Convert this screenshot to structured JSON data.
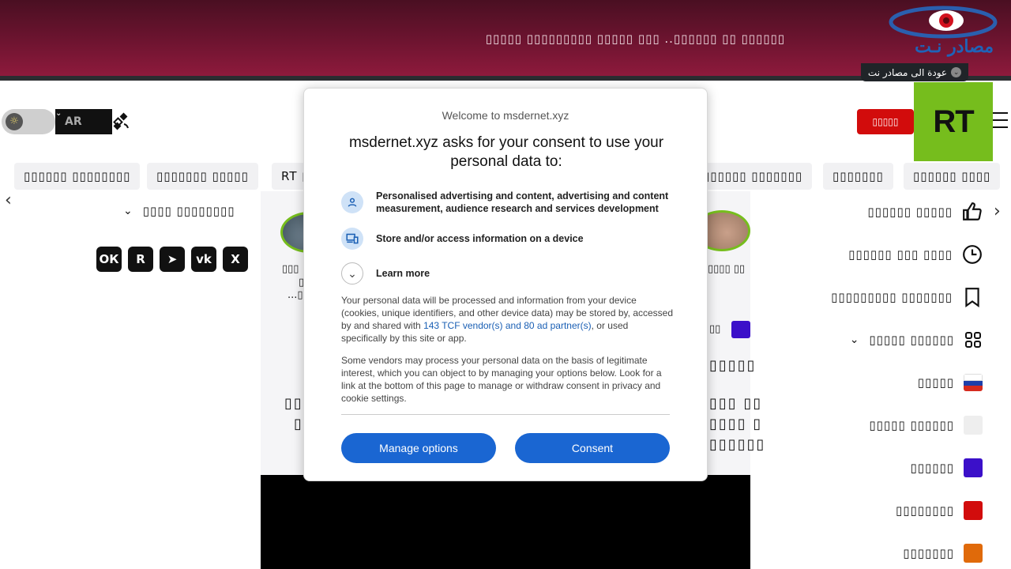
{
  "banner": {
    "headline": "▯▯▯▯▯ ▯▯▯▯▯▯▯▯▯ ▯▯▯▯▯ ▯▯▯ ..▯▯▯▯▯▯ ▯▯ ▯▯▯▯▯▯",
    "logo_word": "مصادر نـت",
    "back_link": "عودة الى مصادر نت"
  },
  "header": {
    "logo": "RT",
    "live_label": "▯▯▯▯▯",
    "language": "AR"
  },
  "nav": {
    "items": [
      "▯▯▯▯▯▯ ▯▯▯▯▯▯▯▯",
      "▯▯▯▯▯▯▯ ▯▯▯▯▯",
      "RT ▯",
      "▯▯▯▯▯▯ ▯▯▯▯▯▯▯",
      "▯▯▯▯▯▯▯",
      "▯▯▯▯▯▯ ▯▯▯▯"
    ]
  },
  "sidebar": {
    "items": [
      {
        "label": "▯▯▯▯▯▯ ▯▯▯▯▯",
        "icon": "thumbs-up-icon"
      },
      {
        "label": "▯▯▯▯▯▯ ▯▯▯ ▯▯▯▯",
        "icon": "clock-icon"
      },
      {
        "label": "▯▯▯▯▯▯▯▯▯ ▯▯▯▯▯▯▯",
        "icon": "bookmark-icon"
      },
      {
        "label": "▯▯▯▯▯ ▯▯▯▯▯▯",
        "icon": "grid-icon"
      },
      {
        "label": "▯▯▯▯▯",
        "icon": "russia-flag-icon"
      },
      {
        "label": "▯▯▯▯▯ ▯▯▯▯▯▯",
        "icon": "blank-square-icon",
        "color": "#eeeeee"
      },
      {
        "label": "▯▯▯▯▯▯",
        "icon": "purple-square-icon",
        "color": "#3b10c9"
      },
      {
        "label": "▯▯▯▯▯▯▯▯",
        "icon": "red-square-icon",
        "color": "#d20c0c"
      },
      {
        "label": "▯▯▯▯▯▯▯",
        "icon": "orange-square-icon",
        "color": "#e06a0a"
      }
    ]
  },
  "left": {
    "heading": "▯▯▯▯ ▯▯▯▯▯▯▯▯",
    "socials": [
      "X",
      "VK",
      "Telegram",
      "R",
      "OK"
    ]
  },
  "center": {
    "caption_left": "▯▯▯",
    "caption_left2": "▯",
    "caption_left3": "...▯",
    "caption_right": "▯▯▯▯ ▯▯",
    "tag_label": "▯▯",
    "headline": "▯▯▯▯▯",
    "body_right_1": "▯▯▯ ▯▯",
    "body_right_2": "▯▯▯▯ ▯",
    "body_right_3": "▯▯▯▯▯▯",
    "body_left_1": "▯▯",
    "body_left_2": "▯"
  },
  "consent": {
    "welcome": "Welcome to msdernet.xyz",
    "title": "msdernet.xyz asks for your consent to use your personal data to:",
    "purposes": [
      "Personalised advertising and content, advertising and content measurement, audience research and services development",
      "Store and/or access information on a device"
    ],
    "learn_more": "Learn more",
    "para1_before": "Your personal data will be processed and information from your device (cookies, unique identifiers, and other device data) may be stored by, accessed by and shared with ",
    "para1_link": "143 TCF vendor(s) and 80 ad partner(s)",
    "para1_after": ", or used specifically by this site or app.",
    "para2": "Some vendors may process your personal data on the basis of legitimate interest, which you can object to by managing your options below. Look for a link at the bottom of this page to manage or withdraw consent in privacy and cookie settings.",
    "manage_label": "Manage options",
    "consent_label": "Consent"
  },
  "colors": {
    "rt_green": "#76bd1d",
    "live_red": "#d20c0c",
    "consent_blue": "#1a66d2"
  }
}
